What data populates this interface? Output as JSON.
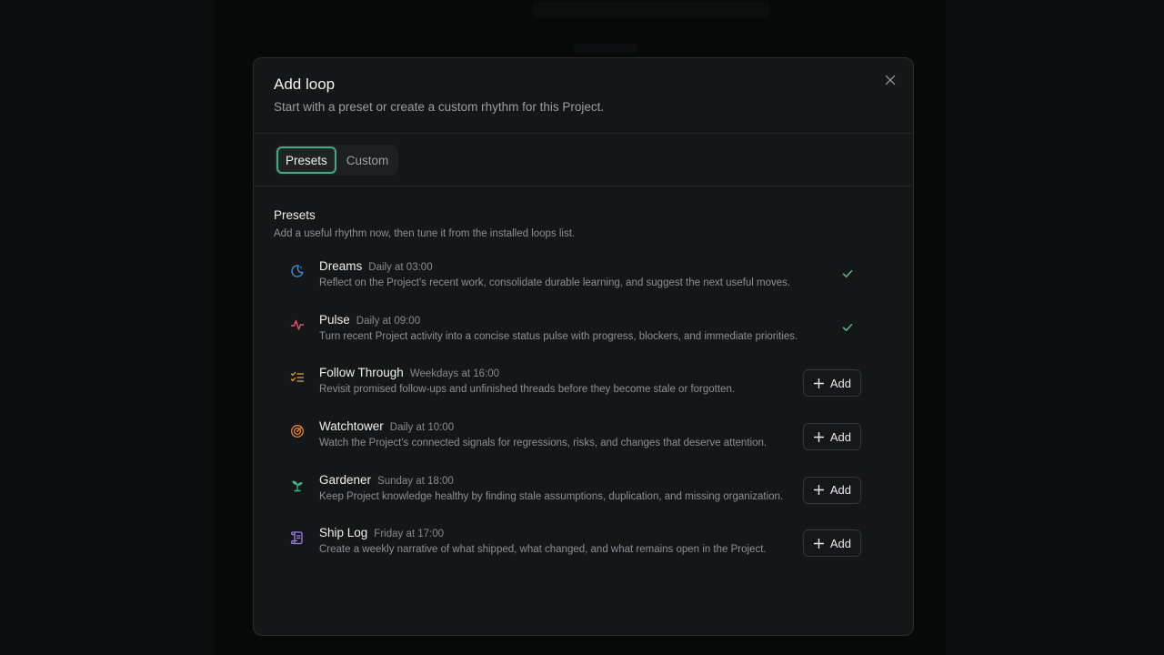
{
  "modal": {
    "title": "Add loop",
    "subtitle": "Start with a preset or create a custom rhythm for this Project.",
    "close_icon": "close-icon"
  },
  "tabs": [
    {
      "label": "Presets",
      "active": true
    },
    {
      "label": "Custom",
      "active": false
    }
  ],
  "presets_section": {
    "title": "Presets",
    "description": "Add a useful rhythm now, then tune it from the installed loops list."
  },
  "presets": [
    {
      "name": "Dreams",
      "schedule": "Daily at 03:00",
      "description": "Reflect on the Project's recent work, consolidate durable learning, and suggest the next useful moves.",
      "icon": "moon-icon",
      "color": "#3d8bd9",
      "installed": true
    },
    {
      "name": "Pulse",
      "schedule": "Daily at 09:00",
      "description": "Turn recent Project activity into a concise status pulse with progress, blockers, and immediate priorities.",
      "icon": "activity-icon",
      "color": "#e0566a",
      "installed": true
    },
    {
      "name": "Follow Through",
      "schedule": "Weekdays at 16:00",
      "description": "Revisit promised follow-ups and unfinished threads before they become stale or forgotten.",
      "icon": "checklist-icon",
      "color": "#e0a040",
      "installed": false
    },
    {
      "name": "Watchtower",
      "schedule": "Daily at 10:00",
      "description": "Watch the Project's connected signals for regressions, risks, and changes that deserve attention.",
      "icon": "radar-icon",
      "color": "#e8823a",
      "installed": false
    },
    {
      "name": "Gardener",
      "schedule": "Sunday at 18:00",
      "description": "Keep Project knowledge healthy by finding stale assumptions, duplication, and missing organization.",
      "icon": "sprout-icon",
      "color": "#3cb883",
      "installed": false
    },
    {
      "name": "Ship Log",
      "schedule": "Friday at 17:00",
      "description": "Create a weekly narrative of what shipped, what changed, and what remains open in the Project.",
      "icon": "scroll-icon",
      "color": "#9a7ee0",
      "installed": false
    }
  ],
  "add_label": "Add",
  "colors": {
    "check": "#5fb896",
    "accent": "#4aa489"
  }
}
